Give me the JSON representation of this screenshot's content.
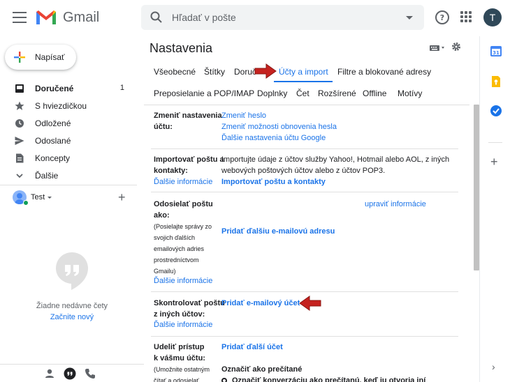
{
  "header": {
    "brand": "Gmail",
    "search_placeholder": "Hľadať v pošte",
    "avatar_letter": "T"
  },
  "sidebar": {
    "compose_label": "Napísať",
    "items": [
      {
        "label": "Doručené",
        "count": "1",
        "icon": "inbox-icon"
      },
      {
        "label": "S hviezdičkou",
        "count": "",
        "icon": "star-icon"
      },
      {
        "label": "Odložené",
        "count": "",
        "icon": "clock-icon"
      },
      {
        "label": "Odoslané",
        "count": "",
        "icon": "send-icon"
      },
      {
        "label": "Koncepty",
        "count": "",
        "icon": "draft-icon"
      },
      {
        "label": "Ďalšie",
        "count": "",
        "icon": "chevron-down-icon"
      }
    ],
    "hangouts_user": "Test",
    "empty_text": "Žiadne nedávne čety",
    "empty_link": "Začnite nový"
  },
  "settings": {
    "title": "Nastavenia",
    "tabs_row1": [
      "Všeobecné",
      "Štítky",
      "Doruč",
      "Účty a import",
      "Filtre a blokované adresy"
    ],
    "tabs_row2": [
      "Preposielanie a POP/IMAP",
      "Doplnky",
      "Čet",
      "Rozšírené",
      "Offline",
      "Motívy"
    ],
    "active_tab": "Účty a import",
    "sections": {
      "change_account": {
        "label1": "Zmeniť nastavenia",
        "label2": "účtu:",
        "links": [
          "Zmeniť heslo",
          "Zmeniť možnosti obnovenia hesla",
          "Ďalšie nastavenia účtu Google"
        ]
      },
      "import": {
        "label1": "Importovať poštu a",
        "label2": "kontakty:",
        "more": "Ďalšie informácie",
        "text1": "Importujte údaje z účtov služby Yahoo!, Hotmail alebo AOL, z iných",
        "text2": "webových poštových účtov alebo z účtov POP3.",
        "action": "Importovať poštu a kontakty"
      },
      "send_as": {
        "label1": "Odosielať poštu",
        "label2": "ako:",
        "sub": [
          "(Posielajte správy zo",
          "svojich ďalších",
          "emailových adries",
          "prostredníctvom",
          "Gmailu)"
        ],
        "more": "Ďalšie informácie",
        "edit": "upraviť informácie",
        "action": "Pridať ďalšiu e-mailovú adresu"
      },
      "check_mail": {
        "label1": "Skontrolovať poštu",
        "label2": "z iných účtov:",
        "more": "Ďalšie informácie",
        "action": "Pridať e-mailový účet"
      },
      "grant_access": {
        "label1": "Udeliť prístup",
        "label2": "k vášmu účtu:",
        "sub1": "(Umožnite ostatným",
        "sub2": "čítať a odosielať",
        "action": "Pridať ďalší účet",
        "mark_read": "Označiť ako prečítané",
        "radio_option": "Označiť konverzáciu ako prečítanú, keď ju otvoria iní"
      }
    }
  },
  "colors": {
    "accent": "#1a73e8",
    "arrow_red": "#c5221f"
  }
}
